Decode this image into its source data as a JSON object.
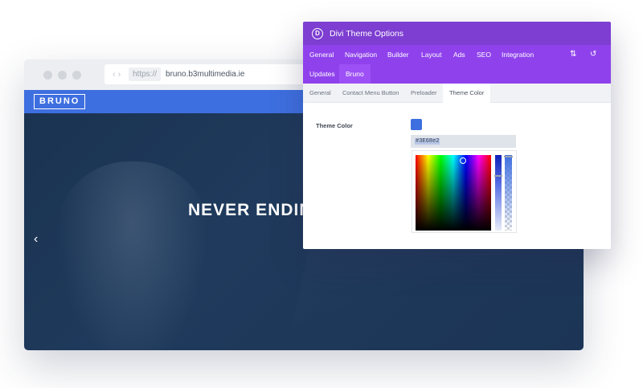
{
  "browser": {
    "url_protocol": "https://",
    "url_host": "bruno.b3multimedia.ie"
  },
  "site": {
    "logo": "BRUNO",
    "hero_title": "NEVER ENDING",
    "prev_arrow": "‹"
  },
  "panel": {
    "logo_letter": "D",
    "title": "Divi Theme Options",
    "tabs": [
      "General",
      "Navigation",
      "Builder",
      "Layout",
      "Ads",
      "SEO",
      "Integration",
      "Updates",
      "Bruno"
    ],
    "active_tab": "Bruno",
    "subtabs": [
      "General",
      "Contact Menu Button",
      "Preloader",
      "Theme Color"
    ],
    "active_subtab": "Theme Color",
    "field_label": "Theme Color",
    "color_value": "#3E6FE0",
    "hex_text": "#3E68e2"
  },
  "colors": {
    "accent_blue": "#3E6FE0",
    "divi_purple": "#8F42EC",
    "divi_purple_dark": "#7D3ED1",
    "hero_navy": "#1F3A5C"
  }
}
